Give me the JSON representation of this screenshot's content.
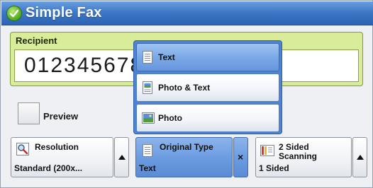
{
  "title": "Simple Fax",
  "recipient": {
    "label": "Recipient",
    "value": "0123456789"
  },
  "preview": {
    "label": "Preview"
  },
  "buttons": {
    "resolution": {
      "title": "Resolution",
      "value": "Standard (200x..."
    },
    "original_type": {
      "title": "Original Type",
      "value": "Text"
    },
    "two_sided": {
      "title_line1": "2 Sided",
      "title_line2": "Scanning",
      "value": "1 Sided"
    }
  },
  "menu": {
    "items": [
      {
        "label": "Text",
        "icon": "text-document-icon",
        "selected": true
      },
      {
        "label": "Photo & Text",
        "icon": "photo-text-document-icon",
        "selected": false
      },
      {
        "label": "Photo",
        "icon": "photo-icon",
        "selected": false
      }
    ]
  },
  "colors": {
    "title_bar": "#3f78c6",
    "recipient_panel": "#d9ec9a",
    "menu_background": "#4f83cf",
    "selected_item": "#78a7e6"
  }
}
